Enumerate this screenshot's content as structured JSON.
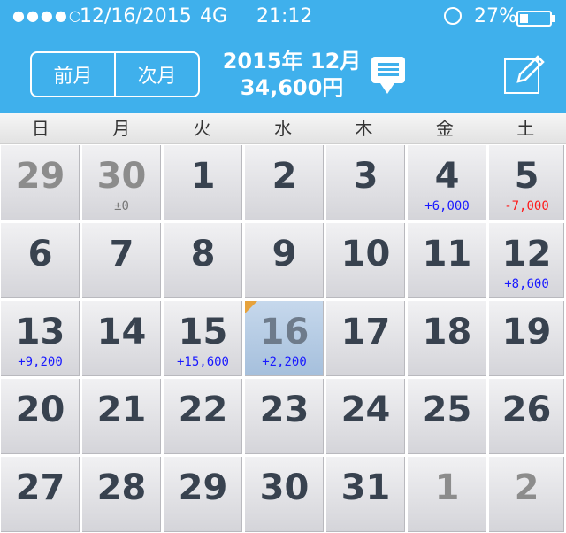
{
  "status": {
    "signal": "●●●●○",
    "date": "12/16/2015",
    "network": "4G",
    "time": "21:12",
    "battery": "27%",
    "battery_level": 0.27
  },
  "header": {
    "prev_label": "前月",
    "next_label": "次月",
    "month": "2015年 12月",
    "total": "34,600円"
  },
  "weekdays": [
    "日",
    "月",
    "火",
    "水",
    "木",
    "金",
    "土"
  ],
  "calendar": {
    "weeks": [
      [
        {
          "day": "29",
          "other": true,
          "amount": "",
          "sign": ""
        },
        {
          "day": "30",
          "other": true,
          "amount": "±0",
          "sign": "zero"
        },
        {
          "day": "1",
          "other": false,
          "amount": "",
          "sign": ""
        },
        {
          "day": "2",
          "other": false,
          "amount": "",
          "sign": ""
        },
        {
          "day": "3",
          "other": false,
          "amount": "",
          "sign": ""
        },
        {
          "day": "4",
          "other": false,
          "amount": "+6,000",
          "sign": "pos"
        },
        {
          "day": "5",
          "other": false,
          "amount": "-7,000",
          "sign": "neg"
        }
      ],
      [
        {
          "day": "6",
          "other": false,
          "amount": "",
          "sign": ""
        },
        {
          "day": "7",
          "other": false,
          "amount": "",
          "sign": ""
        },
        {
          "day": "8",
          "other": false,
          "amount": "",
          "sign": ""
        },
        {
          "day": "9",
          "other": false,
          "amount": "",
          "sign": ""
        },
        {
          "day": "10",
          "other": false,
          "amount": "",
          "sign": ""
        },
        {
          "day": "11",
          "other": false,
          "amount": "",
          "sign": ""
        },
        {
          "day": "12",
          "other": false,
          "amount": "+8,600",
          "sign": "pos"
        }
      ],
      [
        {
          "day": "13",
          "other": false,
          "amount": "+9,200",
          "sign": "pos"
        },
        {
          "day": "14",
          "other": false,
          "amount": "",
          "sign": ""
        },
        {
          "day": "15",
          "other": false,
          "amount": "+15,600",
          "sign": "pos"
        },
        {
          "day": "16",
          "other": false,
          "amount": "+2,200",
          "sign": "pos",
          "selected": true
        },
        {
          "day": "17",
          "other": false,
          "amount": "",
          "sign": ""
        },
        {
          "day": "18",
          "other": false,
          "amount": "",
          "sign": ""
        },
        {
          "day": "19",
          "other": false,
          "amount": "",
          "sign": ""
        }
      ],
      [
        {
          "day": "20",
          "other": false,
          "amount": "",
          "sign": ""
        },
        {
          "day": "21",
          "other": false,
          "amount": "",
          "sign": ""
        },
        {
          "day": "22",
          "other": false,
          "amount": "",
          "sign": ""
        },
        {
          "day": "23",
          "other": false,
          "amount": "",
          "sign": ""
        },
        {
          "day": "24",
          "other": false,
          "amount": "",
          "sign": ""
        },
        {
          "day": "25",
          "other": false,
          "amount": "",
          "sign": ""
        },
        {
          "day": "26",
          "other": false,
          "amount": "",
          "sign": ""
        }
      ],
      [
        {
          "day": "27",
          "other": false,
          "amount": "",
          "sign": ""
        },
        {
          "day": "28",
          "other": false,
          "amount": "",
          "sign": ""
        },
        {
          "day": "29",
          "other": false,
          "amount": "",
          "sign": ""
        },
        {
          "day": "30",
          "other": false,
          "amount": "",
          "sign": ""
        },
        {
          "day": "31",
          "other": false,
          "amount": "",
          "sign": ""
        },
        {
          "day": "1",
          "other": true,
          "amount": "",
          "sign": ""
        },
        {
          "day": "2",
          "other": true,
          "amount": "",
          "sign": ""
        }
      ]
    ]
  },
  "colors": {
    "header_bg": "#3fb0ec",
    "positive": "#1a1aff",
    "negative": "#ff1a1a",
    "today_marker": "#e6a23c"
  },
  "icons": {
    "memo": "chat-bubble-icon",
    "edit": "edit-pencil-icon",
    "lock": "rotation-lock-icon",
    "battery": "battery-icon"
  }
}
